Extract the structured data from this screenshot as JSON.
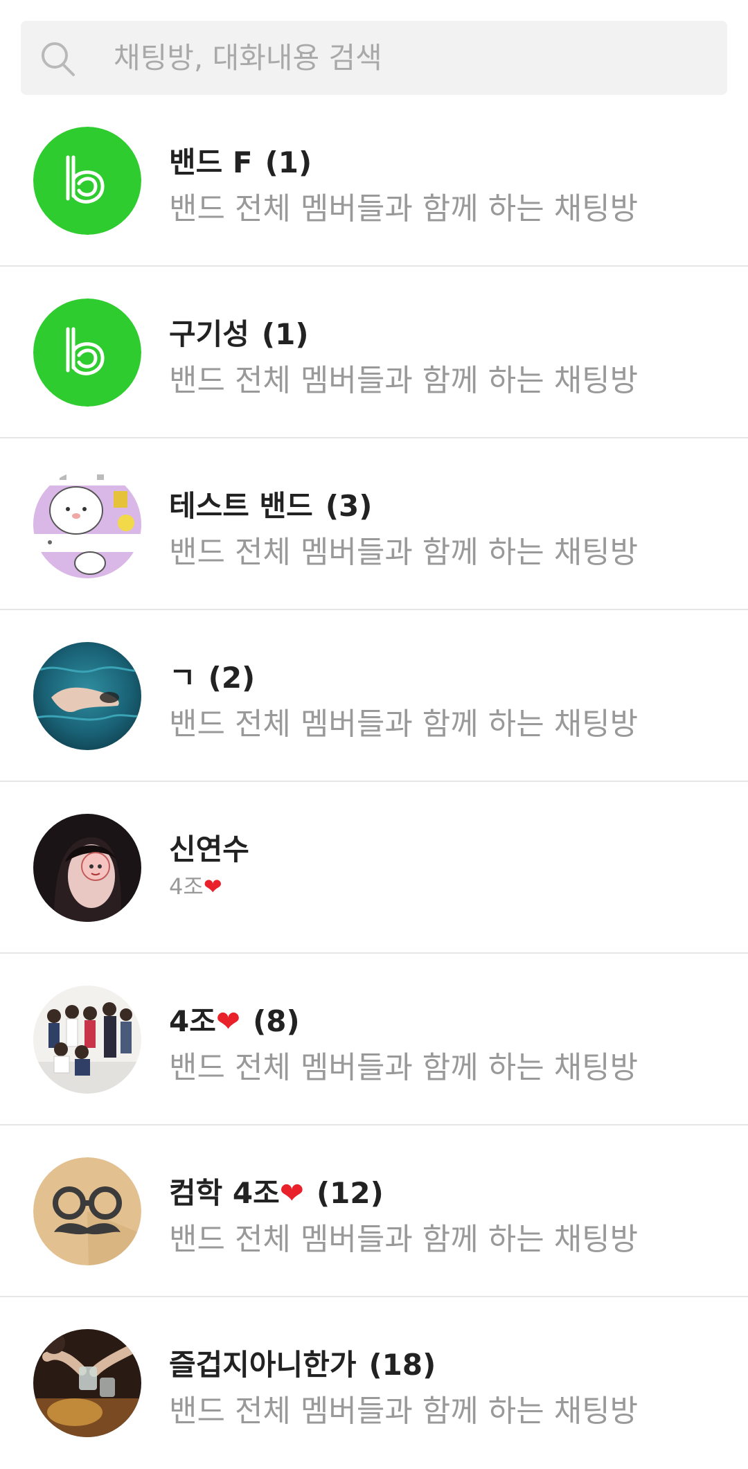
{
  "search": {
    "placeholder": "채팅방, 대화내용 검색",
    "icon": "search-icon"
  },
  "colors": {
    "band_green": "#2ecc2e",
    "subtitle_gray": "#999999",
    "title_dark": "#222222",
    "divider": "#e6e6e6",
    "heart_red": "#e8212b"
  },
  "chats": [
    {
      "title": "밴드 F",
      "count": "(1)",
      "subtitle": "밴드 전체 멤버들과 함께 하는 채팅방",
      "avatar": "band-logo-avatar"
    },
    {
      "title": "구기성",
      "count": "(1)",
      "subtitle": "밴드 전체 멤버들과 함께 하는 채팅방",
      "avatar": "band-logo-avatar"
    },
    {
      "title": "테스트 밴드",
      "count": "(3)",
      "subtitle": "밴드 전체 멤버들과 함께 하는 채팅방",
      "avatar": "cartoon-avatar"
    },
    {
      "title": "ㄱ",
      "count": "(2)",
      "subtitle": "밴드 전체 멤버들과 함께 하는 채팅방",
      "avatar": "water-hand-photo-avatar"
    },
    {
      "title": "신연수",
      "count": "",
      "subtitle": "4조",
      "subtitle_emoji": "❤",
      "avatar": "person-photo-avatar"
    },
    {
      "title": "4조",
      "title_emoji": "❤",
      "count": "(8)",
      "subtitle": "밴드 전체 멤버들과 함께 하는 채팅방",
      "avatar": "group-photo-avatar"
    },
    {
      "title": "컴학 4조",
      "title_emoji": "❤",
      "count": "(12)",
      "subtitle": "밴드 전체 멤버들과 함께 하는 채팅방",
      "avatar": "glasses-mustache-avatar"
    },
    {
      "title": "즐겁지아니한가",
      "count": "(18)",
      "subtitle": "밴드 전체 멤버들과 함께 하는 채팅방",
      "avatar": "toast-photo-avatar"
    }
  ]
}
